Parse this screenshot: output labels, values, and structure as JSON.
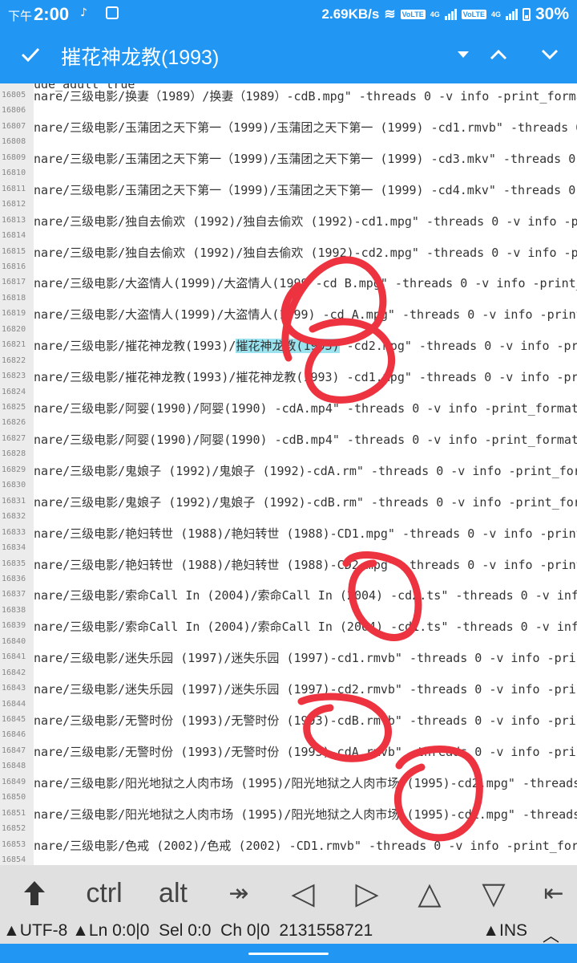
{
  "status": {
    "time": "2:00",
    "ampm": "下午",
    "netspeed": "2.69KB/s",
    "volte": "VoLTE",
    "net": "4G",
    "battery": "30%"
  },
  "toolbar": {
    "title": "摧花神龙教(1993)"
  },
  "editor": {
    "top_partial": "ude_adult true",
    "lines": [
      {
        "num": "16805",
        "text": "nare/三级电影/换妻（1989）/换妻（1989）-cdB.mpg\" -threads 0 -v info -print_format json"
      },
      {
        "num": "16806",
        "text": ""
      },
      {
        "num": "16807",
        "text": "nare/三级电影/玉蒲团之天下第一（1999)/玉蒲团之天下第一 (1999) -cd1.rmvb\" -threads 0 -v in"
      },
      {
        "num": "16808",
        "text": ""
      },
      {
        "num": "16809",
        "text": "nare/三级电影/玉蒲团之天下第一（1999)/玉蒲团之天下第一 (1999) -cd3.mkv\" -threads 0 -v inf"
      },
      {
        "num": "16810",
        "text": ""
      },
      {
        "num": "16811",
        "text": "nare/三级电影/玉蒲团之天下第一（1999)/玉蒲团之天下第一 (1999) -cd4.mkv\" -threads 0 -v inf"
      },
      {
        "num": "16812",
        "text": ""
      },
      {
        "num": "16813",
        "text": "nare/三级电影/独自去偷欢 (1992)/独自去偷欢 (1992)-cd1.mpg\" -threads 0 -v info -print_fo"
      },
      {
        "num": "16814",
        "text": ""
      },
      {
        "num": "16815",
        "text": "nare/三级电影/独自去偷欢 (1992)/独自去偷欢 (1992)-cd2.mpg\" -threads 0 -v info -print_fo"
      },
      {
        "num": "16816",
        "text": ""
      },
      {
        "num": "16817",
        "text": "nare/三级电影/大盗情人(1999)/大盗情人(1999 -cd B.mpg\" -threads 0 -v info -print_forma"
      },
      {
        "num": "16818",
        "text": ""
      },
      {
        "num": "16819",
        "text": "nare/三级电影/大盗情人(1999)/大盗情人(1999) -cd A.mpg\" -threads 0 -v info -print_forma"
      },
      {
        "num": "16820",
        "text": ""
      },
      {
        "num": "16821",
        "pre": "nare/三级电影/摧花神龙教(1993)/",
        "hl": "摧花神龙教(1993)",
        "post": " -cd2.mpg\" -threads 0 -v info -print_fo"
      },
      {
        "num": "16822",
        "text": ""
      },
      {
        "num": "16823",
        "text": "nare/三级电影/摧花神龙教(1993)/摧花神龙教(1993) -cd1.mpg\" -threads 0 -v info -print_fo"
      },
      {
        "num": "16824",
        "text": ""
      },
      {
        "num": "16825",
        "text": "nare/三级电影/阿婴(1990)/阿婴(1990) -cdA.mp4\" -threads 0 -v info -print_format json"
      },
      {
        "num": "16826",
        "text": ""
      },
      {
        "num": "16827",
        "text": "nare/三级电影/阿婴(1990)/阿婴(1990) -cdB.mp4\" -threads 0 -v info -print_format json"
      },
      {
        "num": "16828",
        "text": ""
      },
      {
        "num": "16829",
        "text": "nare/三级电影/鬼娘子 (1992)/鬼娘子 (1992)-cdA.rm\" -threads 0 -v info -print_format js"
      },
      {
        "num": "16830",
        "text": ""
      },
      {
        "num": "16831",
        "text": "nare/三级电影/鬼娘子 (1992)/鬼娘子 (1992)-cdB.rm\" -threads 0 -v info -print_format js"
      },
      {
        "num": "16832",
        "text": ""
      },
      {
        "num": "16833",
        "text": "nare/三级电影/艳妇转世 (1988)/艳妇转世 (1988)-CD1.mpg\" -threads 0 -v info -print_forma"
      },
      {
        "num": "16834",
        "text": ""
      },
      {
        "num": "16835",
        "text": "nare/三级电影/艳妇转世 (1988)/艳妇转世 (1988)-CD2.mpg\" -threads 0 -v info -print_forma"
      },
      {
        "num": "16836",
        "text": ""
      },
      {
        "num": "16837",
        "text": "nare/三级电影/索命Call In (2004)/索命Call In (2004) -cd2.ts\" -threads 0 -v info -pri"
      },
      {
        "num": "16838",
        "text": ""
      },
      {
        "num": "16839",
        "text": "nare/三级电影/索命Call In (2004)/索命Call In (2004) -cd1.ts\" -threads 0 -v info -pri"
      },
      {
        "num": "16840",
        "text": ""
      },
      {
        "num": "16841",
        "text": "nare/三级电影/迷失乐园 (1997)/迷失乐园 (1997)-cd1.rmvb\" -threads 0 -v info -print_form"
      },
      {
        "num": "16842",
        "text": ""
      },
      {
        "num": "16843",
        "text": "nare/三级电影/迷失乐园 (1997)/迷失乐园 (1997)-cd2.rmvb\" -threads 0 -v info -print_form"
      },
      {
        "num": "16844",
        "text": ""
      },
      {
        "num": "16845",
        "text": "nare/三级电影/无警时份 (1993)/无警时份 (1993)-cdB.rmvb\" -threads 0 -v info -print_form"
      },
      {
        "num": "16846",
        "text": ""
      },
      {
        "num": "16847",
        "text": "nare/三级电影/无警时份 (1993)/无警时份 (1993)-cdA.rmvb\" -threads 0 -v info -print_form"
      },
      {
        "num": "16848",
        "text": ""
      },
      {
        "num": "16849",
        "text": "nare/三级电影/阳光地狱之人肉市场 (1995)/阳光地狱之人肉市场 (1995)-cd2.mpg\" -threads 0 -v"
      },
      {
        "num": "16850",
        "text": ""
      },
      {
        "num": "16851",
        "text": "nare/三级电影/阳光地狱之人肉市场 (1995)/阳光地狱之人肉市场 (1995)-cd1.mpg\" -threads 0 -v"
      },
      {
        "num": "16852",
        "text": ""
      },
      {
        "num": "16853",
        "text": "nare/三级电影/色戒 (2002)/色戒 (2002) -CD1.rmvb\" -threads 0 -v info -print_format js"
      },
      {
        "num": "16854",
        "text": ""
      }
    ]
  },
  "keys": {
    "ctrl": "ctrl",
    "alt": "alt",
    "tab": "↠",
    "left": "◁",
    "right": "▷",
    "up": "△",
    "down": "▽",
    "home": "⇤"
  },
  "info": {
    "encoding": "▲UTF-8",
    "line": "▲Ln 0:0|0",
    "sel": "Sel 0:0",
    "ch": "Ch 0|0",
    "size": "2131558721",
    "mode": "▲INS",
    "chevron": "︿"
  },
  "colors": {
    "primary": "#2196f3",
    "highlight": "#9be3ef",
    "annotation": "#ee3340"
  }
}
